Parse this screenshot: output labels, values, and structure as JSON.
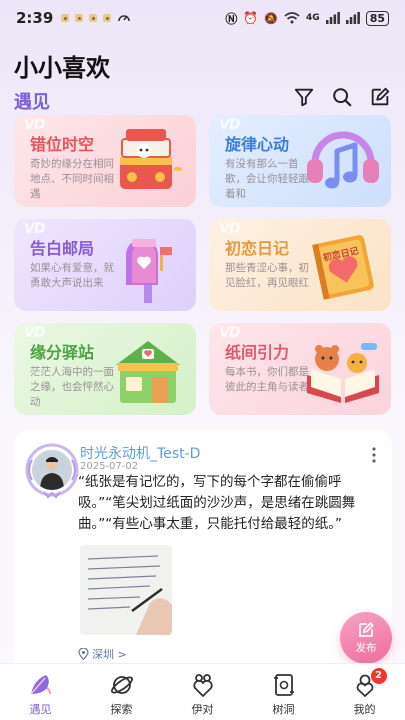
{
  "status_bar": {
    "time": "2:39",
    "network": "4G",
    "battery": "85"
  },
  "header": {
    "app_title": "小小喜欢",
    "section_title": "遇见",
    "icons": [
      "filter-icon",
      "search-icon",
      "edit-icon"
    ]
  },
  "cards": [
    {
      "title": "错位时空",
      "desc": "奇妙的缘分在相同地点、不同时间相遇",
      "illustration": "music-box"
    },
    {
      "title": "旋律心动",
      "desc": "有没有那么一首歌，会让你轻轻跟着和",
      "illustration": "headphones-music-note"
    },
    {
      "title": "告白邮局",
      "desc": "如果心有爱意，就勇敢大声说出来",
      "illustration": "mailbox"
    },
    {
      "title": "初恋日记",
      "desc": "那些青涩心事，初见脸红，再见眼红",
      "illustration": "diary-book",
      "book_label": "初恋日记"
    },
    {
      "title": "缘分驿站",
      "desc": "茫茫人海中的一面之缘，也会怦然心动",
      "illustration": "station-house"
    },
    {
      "title": "纸间引力",
      "desc": "每本书，你们都是彼此的主角与读者",
      "illustration": "open-book"
    }
  ],
  "post": {
    "username": "时光永动机_Test-D",
    "date": "2025-07-02",
    "text": "“纸张是有记忆的，写下的每个字都在偷偷呼吸。”“笔尖划过纸面的沙沙声，是思绪在跳圆舞曲。”“有些心事太重，只能托付给最轻的纸。”",
    "location": "深圳 >"
  },
  "fab": {
    "label": "发布"
  },
  "nav": [
    {
      "label": "遇见",
      "icon": "feather-icon",
      "active": true
    },
    {
      "label": "探索",
      "icon": "planet-icon"
    },
    {
      "label": "伊对",
      "icon": "couple-heart-icon"
    },
    {
      "label": "树洞",
      "icon": "scroll-icon"
    },
    {
      "label": "我的",
      "icon": "profile-heart-icon",
      "badge": "2"
    }
  ],
  "colors": {
    "accent": "#7a61d6",
    "fab": "#ec6d9e",
    "badge": "#f0352f"
  }
}
